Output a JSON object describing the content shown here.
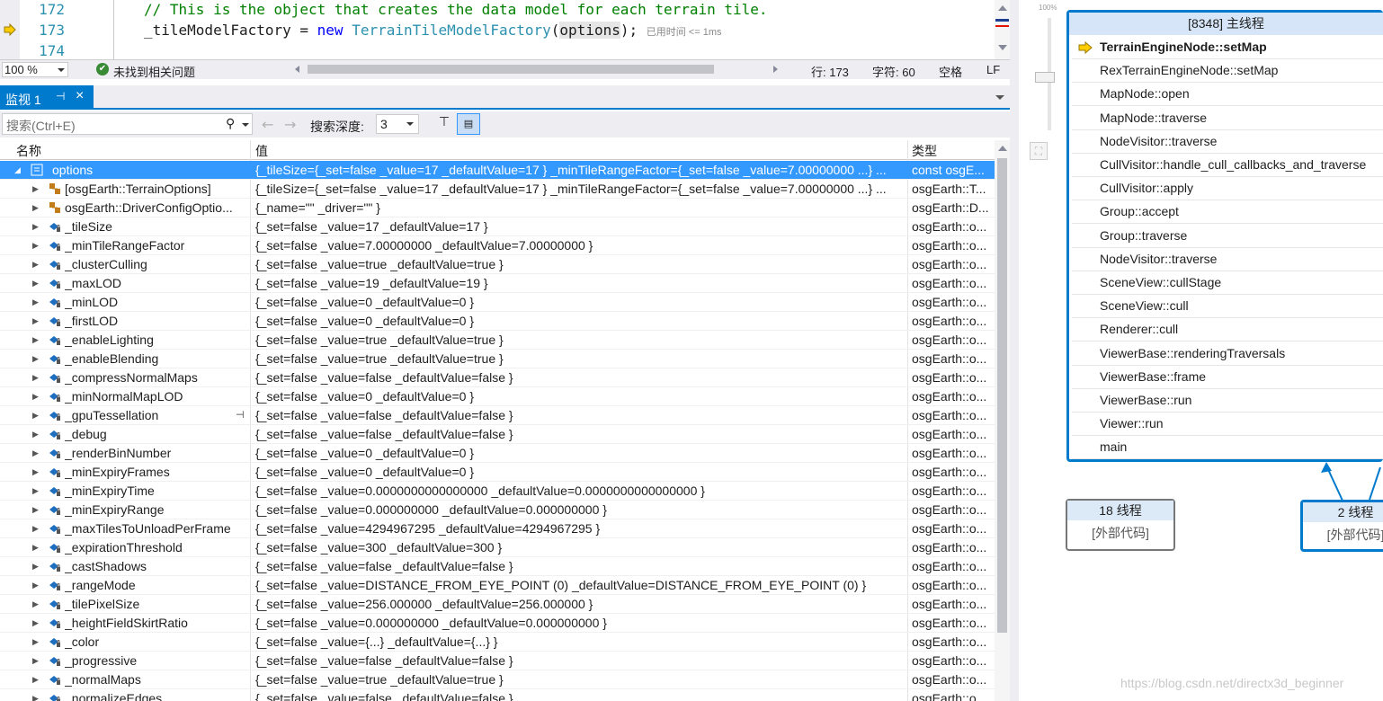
{
  "editor": {
    "lines": [
      {
        "num": "172",
        "comment": "// This is the object that creates the data model for each terrain tile."
      },
      {
        "num": "173",
        "var": "_tileModelFactory = ",
        "kw": "new",
        "type": "TerrainTileModelFactory",
        "open": "(",
        "arg": "options",
        "close": ");",
        "hint": "已用时间 <= 1ms"
      },
      {
        "num": "174"
      }
    ]
  },
  "estatus": {
    "zoom": "100 %",
    "issues": "未找到相关问题",
    "line": "行: 173",
    "char": "字符: 60",
    "space": "空格",
    "eol": "LF"
  },
  "watch": {
    "tab_label": "监视 1",
    "search_placeholder": "搜索(Ctrl+E)",
    "depth_label": "搜索深度:",
    "depth_value": "3",
    "headers": {
      "name": "名称",
      "value": "值",
      "type": "类型"
    },
    "rows": [
      {
        "name": "options",
        "value": "{_tileSize={_set=false _value=17 _defaultValue=17 } _minTileRangeFactor={_set=false _value=7.00000000 ...} ...",
        "type": "const osgE...",
        "level": 0,
        "expanded": true,
        "icon": "object-icon",
        "selected": true
      },
      {
        "name": "[osgEarth::TerrainOptions]",
        "value": "{_tileSize={_set=false _value=17 _defaultValue=17 } _minTileRangeFactor={_set=false _value=7.00000000 ...} ...",
        "type": "osgEarth::T...",
        "level": 1,
        "icon": "base-class-icon"
      },
      {
        "name": "osgEarth::DriverConfigOptio...",
        "value": "{_name=\"\" _driver=\"\" }",
        "type": "osgEarth::D...",
        "level": 1,
        "icon": "base-class-icon"
      },
      {
        "name": "_tileSize",
        "value": "{_set=false _value=17 _defaultValue=17 }",
        "type": "osgEarth::o...",
        "level": 1,
        "icon": "private-field-icon"
      },
      {
        "name": "_minTileRangeFactor",
        "value": "{_set=false _value=7.00000000 _defaultValue=7.00000000 }",
        "type": "osgEarth::o...",
        "level": 1,
        "icon": "private-field-icon"
      },
      {
        "name": "_clusterCulling",
        "value": "{_set=false _value=true _defaultValue=true }",
        "type": "osgEarth::o...",
        "level": 1,
        "icon": "private-field-icon"
      },
      {
        "name": "_maxLOD",
        "value": "{_set=false _value=19 _defaultValue=19 }",
        "type": "osgEarth::o...",
        "level": 1,
        "icon": "private-field-icon"
      },
      {
        "name": "_minLOD",
        "value": "{_set=false _value=0 _defaultValue=0 }",
        "type": "osgEarth::o...",
        "level": 1,
        "icon": "private-field-icon"
      },
      {
        "name": "_firstLOD",
        "value": "{_set=false _value=0 _defaultValue=0 }",
        "type": "osgEarth::o...",
        "level": 1,
        "icon": "private-field-icon"
      },
      {
        "name": "_enableLighting",
        "value": "{_set=false _value=true _defaultValue=true }",
        "type": "osgEarth::o...",
        "level": 1,
        "icon": "private-field-icon"
      },
      {
        "name": "_enableBlending",
        "value": "{_set=false _value=true _defaultValue=true }",
        "type": "osgEarth::o...",
        "level": 1,
        "icon": "private-field-icon"
      },
      {
        "name": "_compressNormalMaps",
        "value": "{_set=false _value=false _defaultValue=false }",
        "type": "osgEarth::o...",
        "level": 1,
        "icon": "private-field-icon"
      },
      {
        "name": "_minNormalMapLOD",
        "value": "{_set=false _value=0 _defaultValue=0 }",
        "type": "osgEarth::o...",
        "level": 1,
        "icon": "private-field-icon"
      },
      {
        "name": "_gpuTessellation",
        "value": "{_set=false _value=false _defaultValue=false }",
        "type": "osgEarth::o...",
        "level": 1,
        "icon": "private-field-icon",
        "pin": true
      },
      {
        "name": "_debug",
        "value": "{_set=false _value=false _defaultValue=false }",
        "type": "osgEarth::o...",
        "level": 1,
        "icon": "private-field-icon"
      },
      {
        "name": "_renderBinNumber",
        "value": "{_set=false _value=0 _defaultValue=0 }",
        "type": "osgEarth::o...",
        "level": 1,
        "icon": "private-field-icon"
      },
      {
        "name": "_minExpiryFrames",
        "value": "{_set=false _value=0 _defaultValue=0 }",
        "type": "osgEarth::o...",
        "level": 1,
        "icon": "private-field-icon"
      },
      {
        "name": "_minExpiryTime",
        "value": "{_set=false _value=0.0000000000000000 _defaultValue=0.0000000000000000 }",
        "type": "osgEarth::o...",
        "level": 1,
        "icon": "private-field-icon"
      },
      {
        "name": "_minExpiryRange",
        "value": "{_set=false _value=0.000000000 _defaultValue=0.000000000 }",
        "type": "osgEarth::o...",
        "level": 1,
        "icon": "private-field-icon"
      },
      {
        "name": "_maxTilesToUnloadPerFrame",
        "value": "{_set=false _value=4294967295 _defaultValue=4294967295 }",
        "type": "osgEarth::o...",
        "level": 1,
        "icon": "private-field-icon"
      },
      {
        "name": "_expirationThreshold",
        "value": "{_set=false _value=300 _defaultValue=300 }",
        "type": "osgEarth::o...",
        "level": 1,
        "icon": "private-field-icon"
      },
      {
        "name": "_castShadows",
        "value": "{_set=false _value=false _defaultValue=false }",
        "type": "osgEarth::o...",
        "level": 1,
        "icon": "private-field-icon"
      },
      {
        "name": "_rangeMode",
        "value": "{_set=false _value=DISTANCE_FROM_EYE_POINT (0) _defaultValue=DISTANCE_FROM_EYE_POINT (0) }",
        "type": "osgEarth::o...",
        "level": 1,
        "icon": "private-field-icon"
      },
      {
        "name": "_tilePixelSize",
        "value": "{_set=false _value=256.000000 _defaultValue=256.000000 }",
        "type": "osgEarth::o...",
        "level": 1,
        "icon": "private-field-icon"
      },
      {
        "name": "_heightFieldSkirtRatio",
        "value": "{_set=false _value=0.000000000 _defaultValue=0.000000000 }",
        "type": "osgEarth::o...",
        "level": 1,
        "icon": "private-field-icon"
      },
      {
        "name": "_color",
        "value": "{_set=false _value={...} _defaultValue={...} }",
        "type": "osgEarth::o...",
        "level": 1,
        "icon": "private-field-icon"
      },
      {
        "name": "_progressive",
        "value": "{_set=false _value=false _defaultValue=false }",
        "type": "osgEarth::o...",
        "level": 1,
        "icon": "private-field-icon"
      },
      {
        "name": "_normalMaps",
        "value": "{_set=false _value=true _defaultValue=true }",
        "type": "osgEarth::o...",
        "level": 1,
        "icon": "private-field-icon"
      },
      {
        "name": "_normalizeEdges",
        "value": "{_set=false _value=false _defaultValue=false }",
        "type": "osgEarth::o...",
        "level": 1,
        "icon": "private-field-icon"
      }
    ]
  },
  "stacks": {
    "zoom_label": "100%",
    "main_thread": "[8348] 主线程",
    "frames": [
      "TerrainEngineNode::setMap",
      "RexTerrainEngineNode::setMap",
      "MapNode::open",
      "MapNode::traverse",
      "NodeVisitor::traverse",
      "CullVisitor::handle_cull_callbacks_and_traverse",
      "CullVisitor::apply",
      "Group::accept",
      "Group::traverse",
      "NodeVisitor::traverse",
      "SceneView::cullStage",
      "SceneView::cull",
      "Renderer::cull",
      "ViewerBase::renderingTraversals",
      "ViewerBase::frame",
      "ViewerBase::run",
      "Viewer::run",
      "main"
    ],
    "thread18": {
      "title": "18 线程",
      "body": "[外部代码]"
    },
    "thread2": {
      "title": "2 线程",
      "body": "[外部代码]"
    },
    "watermark": "https://blog.csdn.net/directx3d_beginner"
  },
  "colors": {
    "accent": "#007acc",
    "selection": "#3399ff",
    "comment": "#008000",
    "keyword": "#0000ff",
    "type": "#2b91af"
  }
}
